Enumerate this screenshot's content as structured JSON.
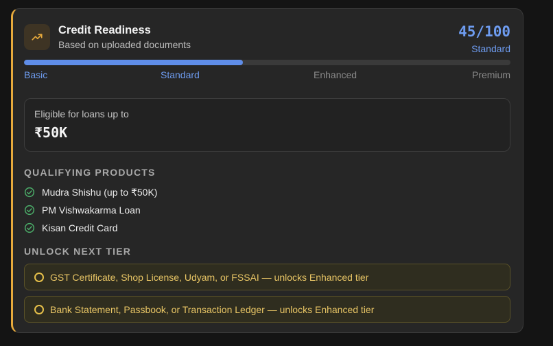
{
  "header": {
    "title": "Credit Readiness",
    "subtitle": "Based on uploaded documents",
    "score": "45/100",
    "tier": "Standard",
    "icon": "trending-up-icon"
  },
  "progress": {
    "value": 45,
    "max": 100,
    "tiers": [
      "Basic",
      "Standard",
      "Enhanced",
      "Premium"
    ]
  },
  "eligibility": {
    "label": "Eligible for loans up to",
    "amount": "₹50K"
  },
  "qualifying": {
    "title": "QUALIFYING PRODUCTS",
    "items": [
      "Mudra Shishu (up to ₹50K)",
      "PM Vishwakarma Loan",
      "Kisan Credit Card"
    ]
  },
  "unlock": {
    "title": "UNLOCK NEXT TIER",
    "items": [
      "GST Certificate, Shop License, Udyam, or FSSAI — unlocks Enhanced tier",
      "Bank Statement, Passbook, or Transaction Ledger — unlocks Enhanced tier"
    ]
  },
  "colors": {
    "accent_blue": "#6e9cf0",
    "accent_orange": "#e6a93c",
    "success_green": "#4caf6a",
    "warning_yellow": "#e8c565"
  }
}
